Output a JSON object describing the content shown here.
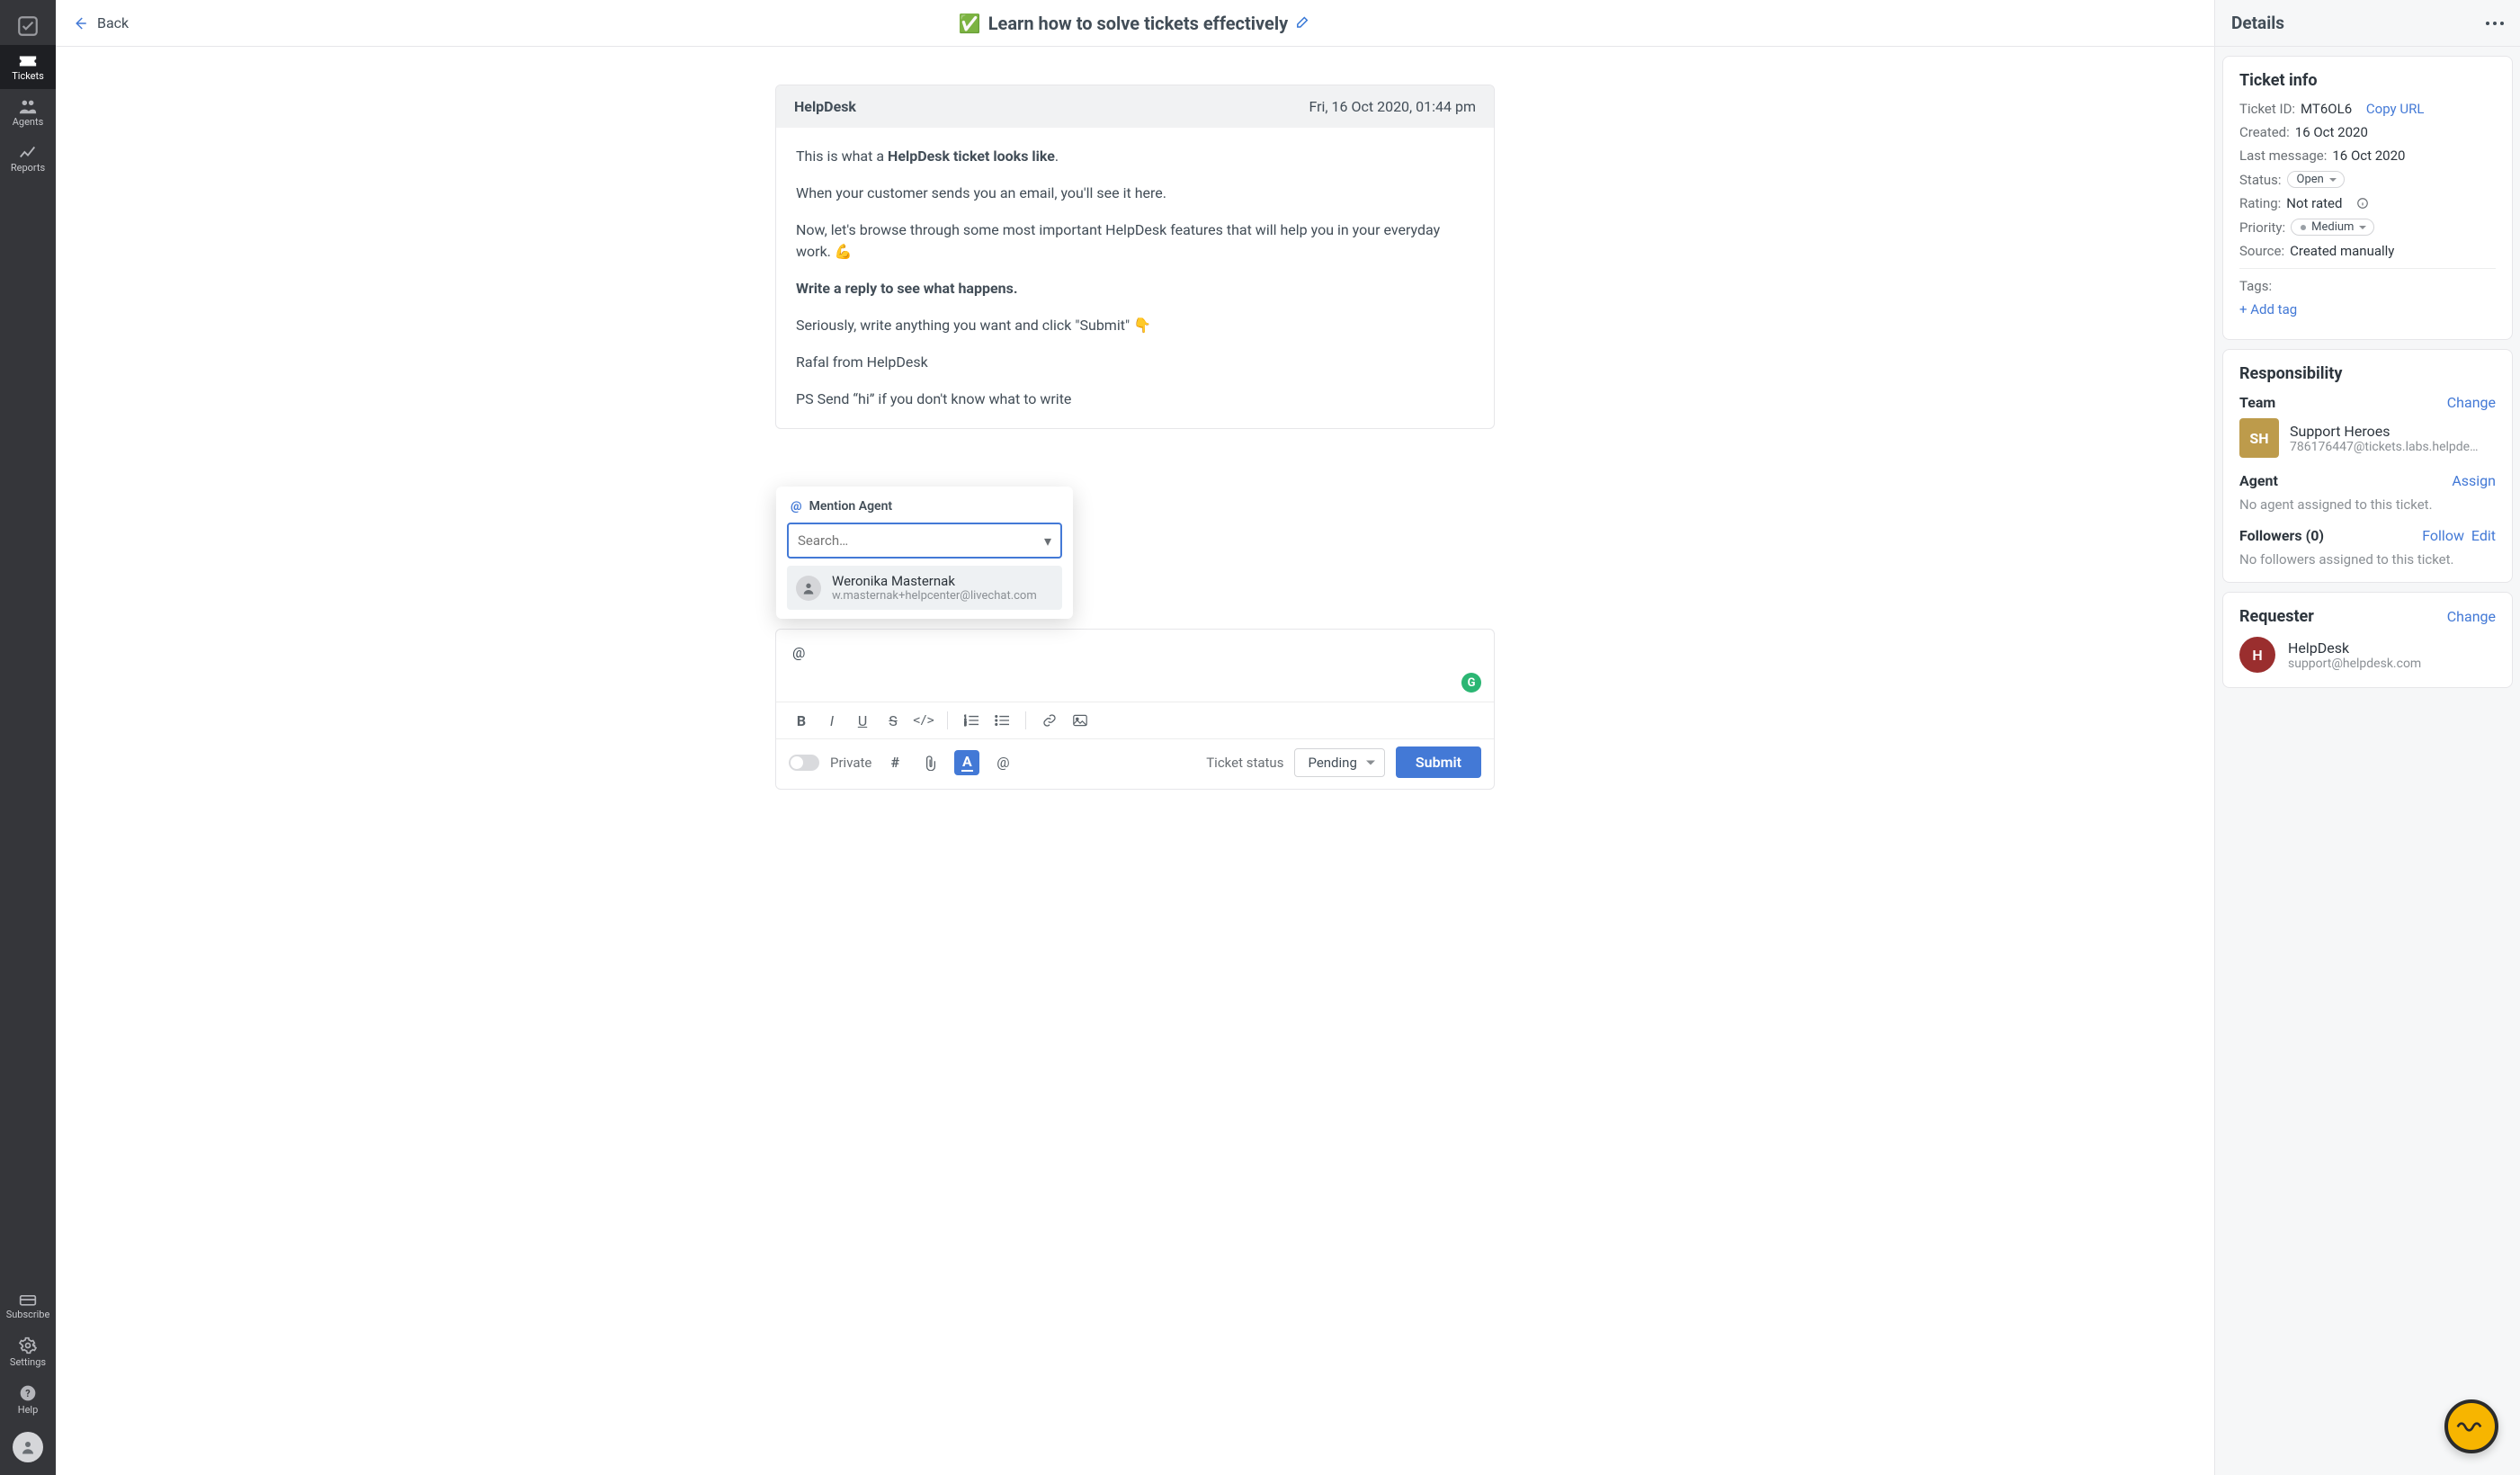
{
  "sidebar": {
    "items": [
      {
        "label": "Tickets"
      },
      {
        "label": "Agents"
      },
      {
        "label": "Reports"
      }
    ],
    "bottom": [
      {
        "label": "Subscribe"
      },
      {
        "label": "Settings"
      },
      {
        "label": "Help"
      }
    ]
  },
  "topbar": {
    "back": "Back",
    "title_emoji": "✅",
    "title": "Learn how to solve tickets effectively"
  },
  "message": {
    "from": "HelpDesk",
    "date": "Fri, 16 Oct 2020, 01:44 pm",
    "p1_prefix": "This is what a ",
    "p1_bold": "HelpDesk ticket looks like",
    "p1_suffix": ".",
    "p2": "When your customer sends you an email, you'll see it here.",
    "p3": "Now, let's browse through some most important HelpDesk features that will help you in your everyday work. 💪",
    "p4": "Write a reply to see what happens.",
    "p5": "Seriously, write anything you want and click \"Submit\" 👇",
    "p6": "Rafal from HelpDesk",
    "p7": "PS Send “hi” if you don't know what to write"
  },
  "mention": {
    "header": "Mention Agent",
    "placeholder": "Search…",
    "option_name": "Weronika Masternak",
    "option_email": "w.masternak+helpcenter@livechat.com"
  },
  "reply": {
    "text": "@",
    "private": "Private",
    "status_label": "Ticket status",
    "status_value": "Pending",
    "submit": "Submit"
  },
  "details": {
    "header": "Details",
    "ticket_info": "Ticket info",
    "ticket_id_lbl": "Ticket ID:",
    "ticket_id": "MT6OL6",
    "copy_url": "Copy URL",
    "created_lbl": "Created:",
    "created": "16 Oct 2020",
    "lastmsg_lbl": "Last message:",
    "lastmsg": "16 Oct 2020",
    "status_lbl": "Status:",
    "status": "Open",
    "rating_lbl": "Rating:",
    "rating": "Not rated",
    "priority_lbl": "Priority:",
    "priority": "Medium",
    "source_lbl": "Source:",
    "source": "Created manually",
    "tags_lbl": "Tags:",
    "add_tag": "+ Add tag",
    "responsibility": "Responsibility",
    "team_lbl": "Team",
    "change": "Change",
    "team_badge": "SH",
    "team_name": "Support Heroes",
    "team_email": "786176447@tickets.labs.helpdesk…",
    "agent_lbl": "Agent",
    "assign": "Assign",
    "agent_none": "No agent assigned to this ticket.",
    "followers_lbl": "Followers (0)",
    "follow": "Follow",
    "edit": "Edit",
    "followers_none": "No followers assigned to this ticket.",
    "requester": "Requester",
    "req_badge": "H",
    "req_name": "HelpDesk",
    "req_email": "support@helpdesk.com"
  }
}
